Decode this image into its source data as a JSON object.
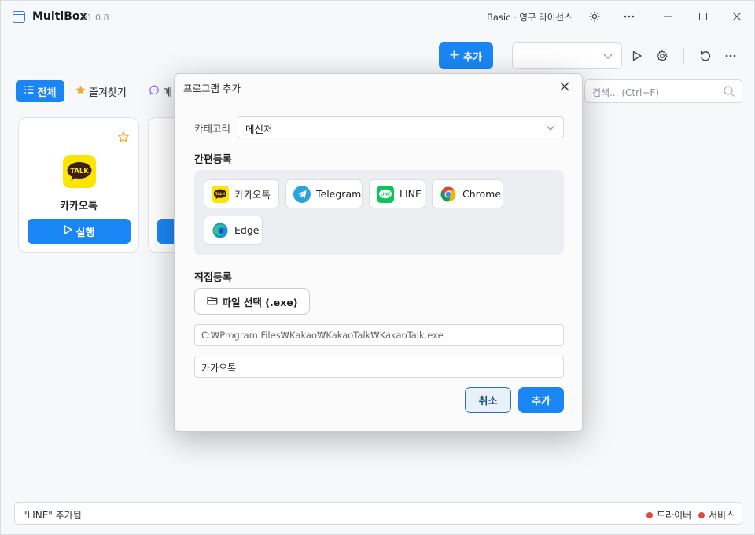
{
  "app": {
    "name": "MultiBox",
    "version": "v1.0.8",
    "license": "Basic · 영구 라이선스"
  },
  "toolbar": {
    "add_label": "추가",
    "profile_value": ""
  },
  "tabs": {
    "all": "전체",
    "favorites": "즐겨찾기",
    "messenger_partial": "메"
  },
  "search": {
    "placeholder": "검색... (Ctrl+F)"
  },
  "cards": [
    {
      "name": "카카오톡",
      "run_label": "실행",
      "logo_text": "TALK"
    }
  ],
  "status": {
    "message": "\"LINE\" 추가됨",
    "indicators": [
      "드라이버",
      "서비스"
    ]
  },
  "modal": {
    "title": "프로그램 추가",
    "category_label": "카테고리",
    "category_value": "메신저",
    "quick_title": "간편등록",
    "quick_items": [
      {
        "label": "카카오톡",
        "icon": "kakaotalk-icon"
      },
      {
        "label": "Telegram",
        "icon": "telegram-icon"
      },
      {
        "label": "LINE",
        "icon": "line-icon"
      },
      {
        "label": "Chrome",
        "icon": "chrome-icon"
      },
      {
        "label": "Edge",
        "icon": "edge-icon"
      }
    ],
    "manual_title": "직접등록",
    "file_button": "파일 선택 (.exe)",
    "path_value": "C:₩Program Files₩Kakao₩KakaoTalk₩KakaoTalk.exe",
    "name_value": "카카오톡",
    "cancel_label": "취소",
    "confirm_label": "추가"
  },
  "colors": {
    "accent": "#1a86f5",
    "kakao_yellow": "#fee500",
    "line_green": "#06c755",
    "telegram_blue": "#2aa3df",
    "status_red": "#e14a3a"
  }
}
